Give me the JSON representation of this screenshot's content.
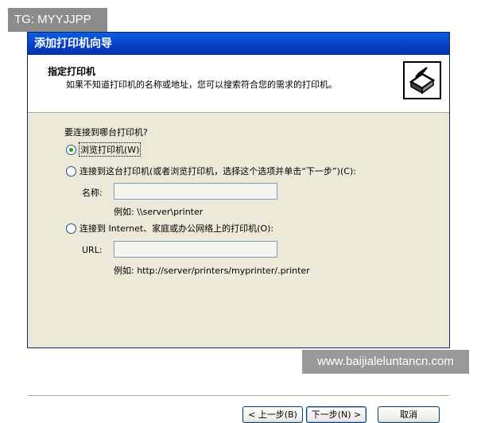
{
  "watermarks": {
    "top": "TG: MYYJJPP",
    "bottom": "www.baijialeluntancn.com"
  },
  "window": {
    "title": "添加打印机向导"
  },
  "header": {
    "title": "指定打印机",
    "subtitle": "如果不知道打印机的名称或地址，您可以搜索符合您的需求的打印机。",
    "icon": "printer-icon"
  },
  "content": {
    "question": "要连接到哪台打印机?",
    "option_browse": "浏览打印机(W)",
    "option_connect": "连接到这台打印机(或者浏览打印机，选择这个选项并单击“下一步”)(C):",
    "name_label": "名称:",
    "name_value": "",
    "name_example": "例如: \\\\server\\printer",
    "option_internet": "连接到 Internet、家庭或办公网络上的打印机(O):",
    "url_label": "URL:",
    "url_value": "",
    "url_example": "例如: http://server/printers/myprinter/.printer",
    "selected_option": "browse"
  },
  "buttons": {
    "back": "< 上一步(B)",
    "next": "下一步(N) >",
    "cancel": "取消"
  }
}
